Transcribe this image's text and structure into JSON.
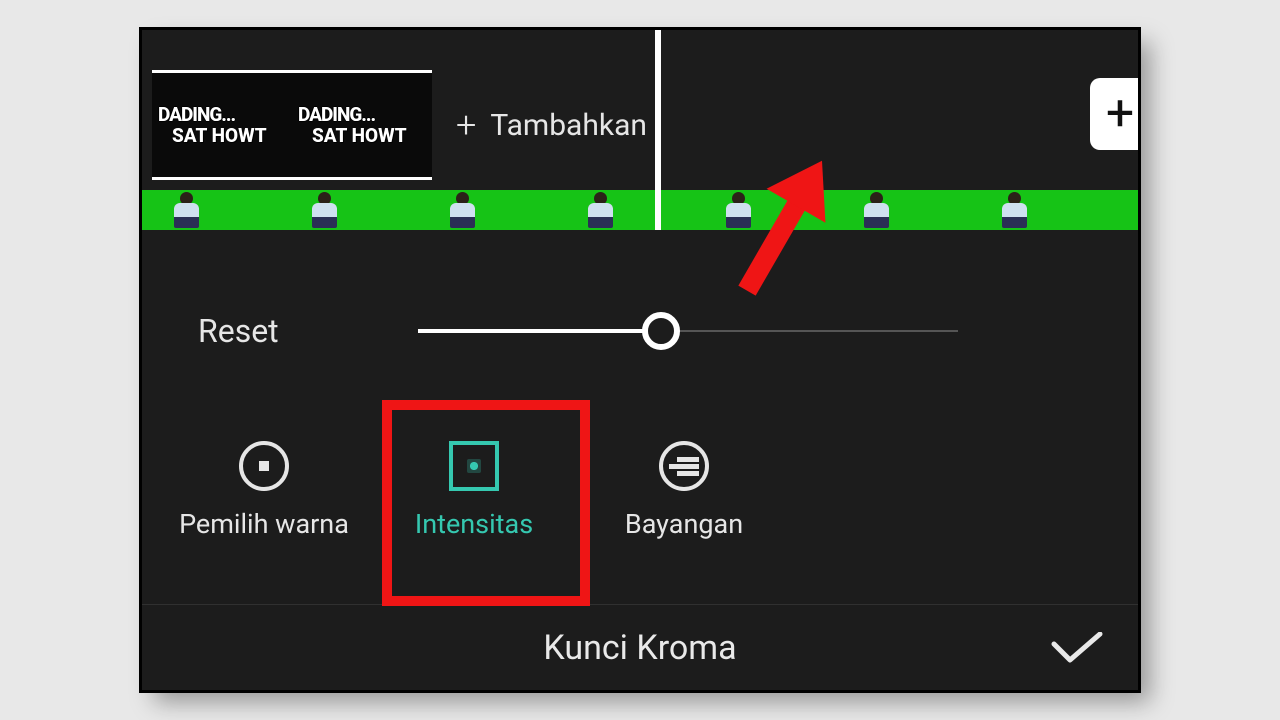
{
  "toolbar": {
    "add_label": "Tambahkan"
  },
  "clip": {
    "thumb_line1": "DADING...",
    "thumb_line2": "SAT HOWT"
  },
  "slider": {
    "reset_label": "Reset",
    "value_percent": 45
  },
  "options": {
    "picker": "Pemilih warna",
    "intensity": "Intensitas",
    "shadow": "Bayangan"
  },
  "panel_title": "Kunci Kroma",
  "accent_color": "#35c8b0"
}
